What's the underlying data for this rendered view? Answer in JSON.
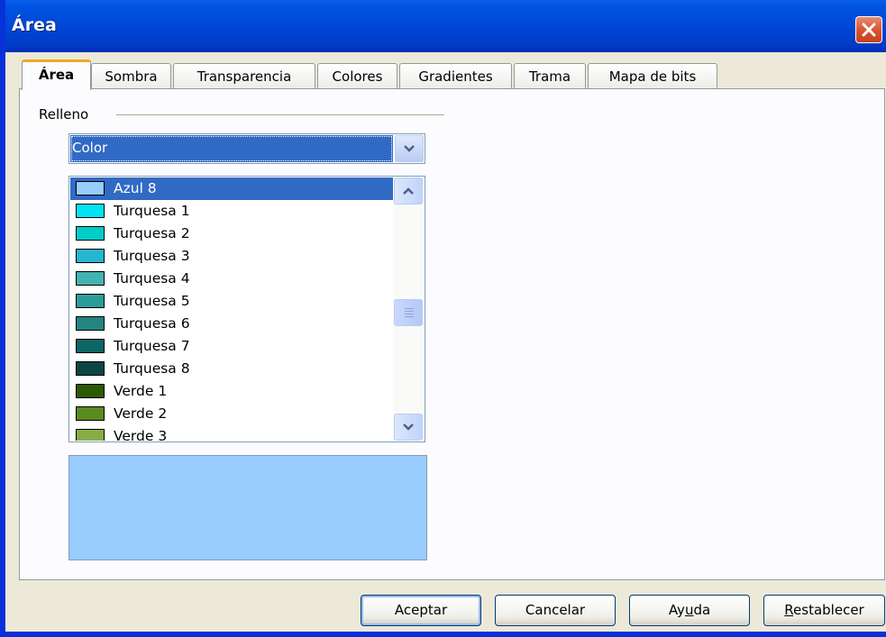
{
  "window": {
    "title": "Área"
  },
  "tabs": [
    {
      "label": "Área",
      "active": true
    },
    {
      "label": "Sombra",
      "active": false
    },
    {
      "label": "Transparencia",
      "active": false
    },
    {
      "label": "Colores",
      "active": false
    },
    {
      "label": "Gradientes",
      "active": false
    },
    {
      "label": "Trama",
      "active": false
    },
    {
      "label": "Mapa de bits",
      "active": false
    }
  ],
  "fill": {
    "group_label": "Relleno",
    "type_selected": "Color"
  },
  "color_list": {
    "items": [
      {
        "label": "Azul 8",
        "color": "#99ccff",
        "selected": true
      },
      {
        "label": "Turquesa 1",
        "color": "#00e3f3",
        "selected": false
      },
      {
        "label": "Turquesa 2",
        "color": "#00cdc7",
        "selected": false
      },
      {
        "label": "Turquesa 3",
        "color": "#26b6d1",
        "selected": false
      },
      {
        "label": "Turquesa 4",
        "color": "#43b3b1",
        "selected": false
      },
      {
        "label": "Turquesa 5",
        "color": "#2c9c99",
        "selected": false
      },
      {
        "label": "Turquesa 6",
        "color": "#218581",
        "selected": false
      },
      {
        "label": "Turquesa 7",
        "color": "#0c6664",
        "selected": false
      },
      {
        "label": "Turquesa 8",
        "color": "#0b4645",
        "selected": false
      },
      {
        "label": "Verde 1",
        "color": "#2d5a00",
        "selected": false
      },
      {
        "label": "Verde 2",
        "color": "#5a8a20",
        "selected": false
      },
      {
        "label": "Verde 3",
        "color": "#88ad48",
        "selected": false
      }
    ]
  },
  "preview": {
    "color": "#99ccff"
  },
  "buttons": {
    "ok": "Aceptar",
    "cancel": "Cancelar",
    "help": "Ayuda",
    "reset": "Restablecer"
  }
}
